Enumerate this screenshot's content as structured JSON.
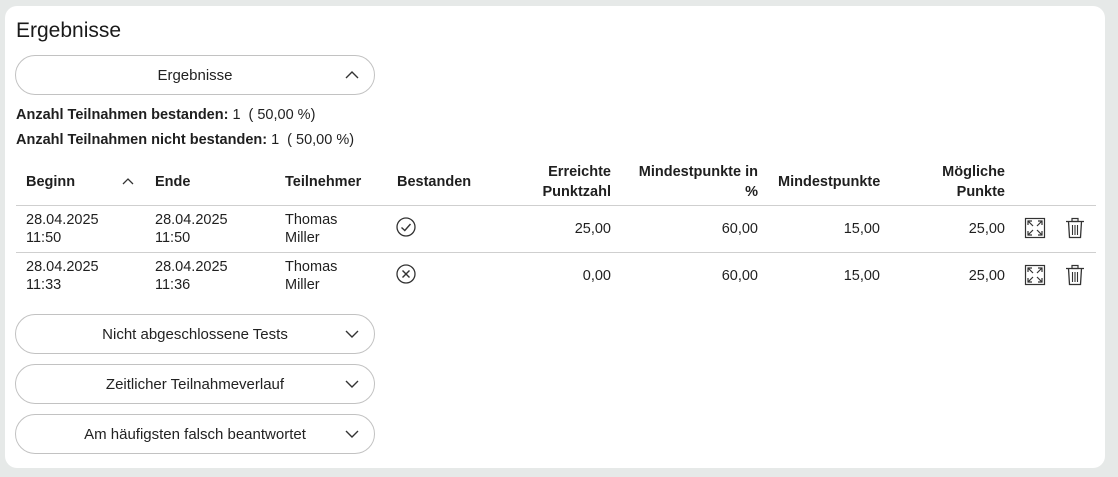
{
  "page": {
    "title": "Ergebnisse"
  },
  "sections": {
    "results": {
      "label": "Ergebnisse",
      "expanded": true,
      "chevron": "chevron-up-icon"
    },
    "incomplete": {
      "label": "Nicht abgeschlossene Tests",
      "expanded": false,
      "chevron": "chevron-down-icon"
    },
    "timeline": {
      "label": "Zeitlicher Teilnahmeverlauf",
      "expanded": false,
      "chevron": "chevron-down-icon"
    },
    "frequent_wrong": {
      "label": "Am häufigsten falsch beantwortet",
      "expanded": false,
      "chevron": "chevron-down-icon"
    }
  },
  "stats": {
    "passed_label": "Anzahl Teilnahmen bestanden:",
    "passed_count": "1",
    "passed_pct": "( 50,00 %)",
    "failed_label": "Anzahl Teilnahmen nicht bestanden:",
    "failed_count": "1",
    "failed_pct": "( 50,00 %)"
  },
  "table": {
    "headers": {
      "begin": "Beginn",
      "end": "Ende",
      "participant": "Teilnehmer",
      "passed": "Bestanden",
      "achieved_l1": "Erreichte",
      "achieved_l2": "Punktzahl",
      "min_pct_l1": "Mindestpunkte in",
      "min_pct_l2": "%",
      "min_points": "Mindestpunkte",
      "possible_l1": "Mögliche",
      "possible_l2": "Punkte"
    },
    "sort": {
      "column": "begin",
      "direction": "ascending",
      "icon": "chevron-up-icon"
    },
    "rows": [
      {
        "begin_date": "28.04.2025",
        "begin_time": "11:50",
        "end_date": "28.04.2025",
        "end_time": "11:50",
        "first_name": "Thomas",
        "last_name": "Miller",
        "passed": true,
        "status_icon": "check-circle-icon",
        "achieved": "25,00",
        "min_pct": "60,00",
        "min_points": "15,00",
        "possible": "25,00"
      },
      {
        "begin_date": "28.04.2025",
        "begin_time": "11:33",
        "end_date": "28.04.2025",
        "end_time": "11:36",
        "first_name": "Thomas",
        "last_name": "Miller",
        "passed": false,
        "status_icon": "x-circle-icon",
        "achieved": "0,00",
        "min_pct": "60,00",
        "min_points": "15,00",
        "possible": "25,00"
      }
    ],
    "row_actions": [
      "expand-icon",
      "trash-icon"
    ]
  },
  "colors": {
    "background": "#e6e9e8",
    "card": "#ffffff",
    "border": "#c2c2c2",
    "divider": "#cfcfcf",
    "text": "#1f1f1f"
  }
}
